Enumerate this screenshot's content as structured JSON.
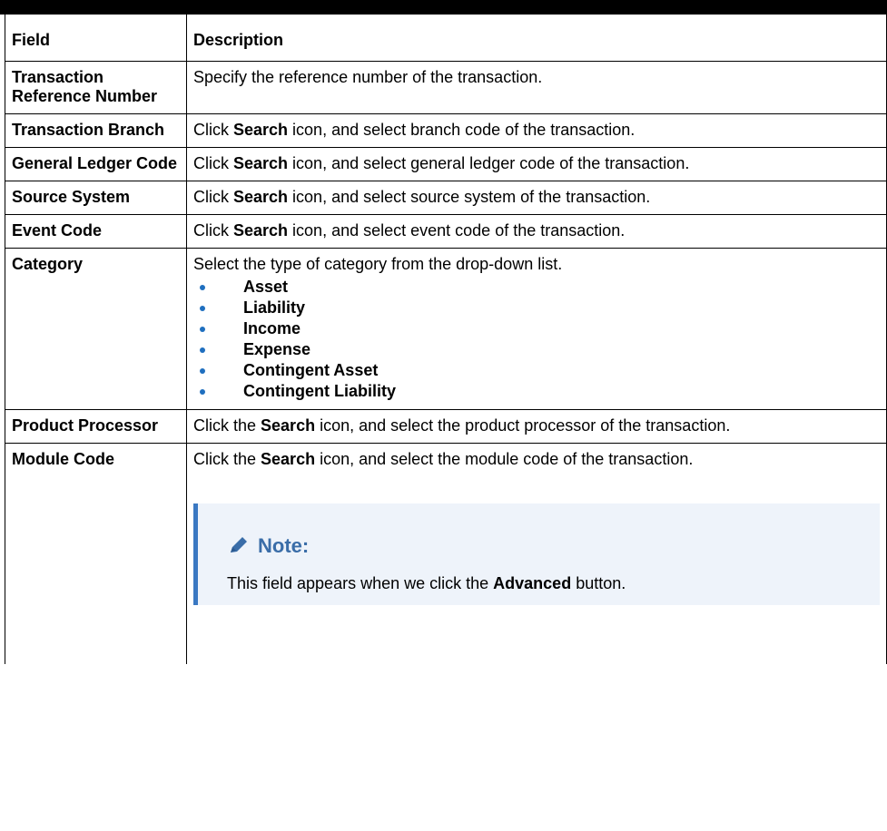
{
  "table": {
    "headers": {
      "field": "Field",
      "description": "Description"
    },
    "rows": {
      "txn_ref": {
        "field": "Transaction Reference Number",
        "desc": "Specify the reference number of the transaction."
      },
      "txn_branch": {
        "field": "Transaction Branch",
        "pre": "Click ",
        "bold": "Search",
        "post": " icon, and select branch code of the transaction."
      },
      "gl_code": {
        "field": "General Ledger Code",
        "pre": "Click ",
        "bold": "Search",
        "post": " icon, and select general ledger code of the transaction."
      },
      "source_system": {
        "field": "Source System",
        "pre": "Click ",
        "bold": "Search",
        "post": " icon, and select source system of the transaction."
      },
      "event_code": {
        "field": "Event Code",
        "pre": "Click ",
        "bold": "Search",
        "post": " icon, and select event code of the transaction."
      },
      "category": {
        "field": "Category",
        "desc": "Select the type of category from the drop-down list.",
        "options": [
          "Asset",
          "Liability",
          "Income",
          "Expense",
          "Contingent Asset",
          "Contingent Liability"
        ]
      },
      "product_processor": {
        "field": "Product Processor",
        "pre": "Click the ",
        "bold": "Search",
        "post": " icon, and select the product processor of the transaction."
      },
      "module_code": {
        "field": "Module Code",
        "pre": "Click the ",
        "bold": "Search",
        "post": " icon, and select the module code of the transaction.",
        "note": {
          "icon": "pencil-icon",
          "title": "Note:",
          "pre": "This field appears when we click the ",
          "bold": "Advanced",
          "post": " button."
        }
      }
    }
  },
  "colors": {
    "bullet": "#1f6fbf",
    "note_accent": "#3a78c2",
    "note_bg": "#eef3fa",
    "note_title": "#3a6da8"
  }
}
